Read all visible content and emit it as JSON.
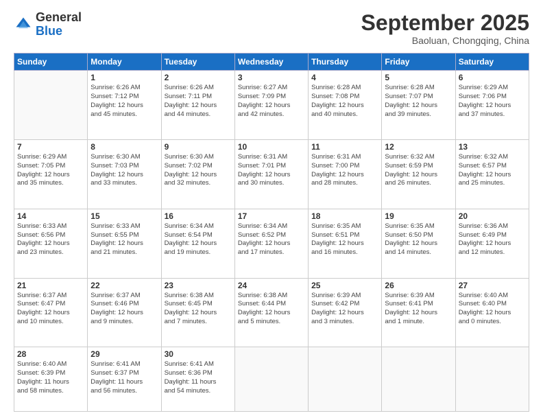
{
  "logo": {
    "general": "General",
    "blue": "Blue"
  },
  "header": {
    "month": "September 2025",
    "location": "Baoluan, Chongqing, China"
  },
  "weekdays": [
    "Sunday",
    "Monday",
    "Tuesday",
    "Wednesday",
    "Thursday",
    "Friday",
    "Saturday"
  ],
  "weeks": [
    [
      {
        "day": "",
        "info": ""
      },
      {
        "day": "1",
        "info": "Sunrise: 6:26 AM\nSunset: 7:12 PM\nDaylight: 12 hours\nand 45 minutes."
      },
      {
        "day": "2",
        "info": "Sunrise: 6:26 AM\nSunset: 7:11 PM\nDaylight: 12 hours\nand 44 minutes."
      },
      {
        "day": "3",
        "info": "Sunrise: 6:27 AM\nSunset: 7:09 PM\nDaylight: 12 hours\nand 42 minutes."
      },
      {
        "day": "4",
        "info": "Sunrise: 6:28 AM\nSunset: 7:08 PM\nDaylight: 12 hours\nand 40 minutes."
      },
      {
        "day": "5",
        "info": "Sunrise: 6:28 AM\nSunset: 7:07 PM\nDaylight: 12 hours\nand 39 minutes."
      },
      {
        "day": "6",
        "info": "Sunrise: 6:29 AM\nSunset: 7:06 PM\nDaylight: 12 hours\nand 37 minutes."
      }
    ],
    [
      {
        "day": "7",
        "info": "Sunrise: 6:29 AM\nSunset: 7:05 PM\nDaylight: 12 hours\nand 35 minutes."
      },
      {
        "day": "8",
        "info": "Sunrise: 6:30 AM\nSunset: 7:03 PM\nDaylight: 12 hours\nand 33 minutes."
      },
      {
        "day": "9",
        "info": "Sunrise: 6:30 AM\nSunset: 7:02 PM\nDaylight: 12 hours\nand 32 minutes."
      },
      {
        "day": "10",
        "info": "Sunrise: 6:31 AM\nSunset: 7:01 PM\nDaylight: 12 hours\nand 30 minutes."
      },
      {
        "day": "11",
        "info": "Sunrise: 6:31 AM\nSunset: 7:00 PM\nDaylight: 12 hours\nand 28 minutes."
      },
      {
        "day": "12",
        "info": "Sunrise: 6:32 AM\nSunset: 6:59 PM\nDaylight: 12 hours\nand 26 minutes."
      },
      {
        "day": "13",
        "info": "Sunrise: 6:32 AM\nSunset: 6:57 PM\nDaylight: 12 hours\nand 25 minutes."
      }
    ],
    [
      {
        "day": "14",
        "info": "Sunrise: 6:33 AM\nSunset: 6:56 PM\nDaylight: 12 hours\nand 23 minutes."
      },
      {
        "day": "15",
        "info": "Sunrise: 6:33 AM\nSunset: 6:55 PM\nDaylight: 12 hours\nand 21 minutes."
      },
      {
        "day": "16",
        "info": "Sunrise: 6:34 AM\nSunset: 6:54 PM\nDaylight: 12 hours\nand 19 minutes."
      },
      {
        "day": "17",
        "info": "Sunrise: 6:34 AM\nSunset: 6:52 PM\nDaylight: 12 hours\nand 17 minutes."
      },
      {
        "day": "18",
        "info": "Sunrise: 6:35 AM\nSunset: 6:51 PM\nDaylight: 12 hours\nand 16 minutes."
      },
      {
        "day": "19",
        "info": "Sunrise: 6:35 AM\nSunset: 6:50 PM\nDaylight: 12 hours\nand 14 minutes."
      },
      {
        "day": "20",
        "info": "Sunrise: 6:36 AM\nSunset: 6:49 PM\nDaylight: 12 hours\nand 12 minutes."
      }
    ],
    [
      {
        "day": "21",
        "info": "Sunrise: 6:37 AM\nSunset: 6:47 PM\nDaylight: 12 hours\nand 10 minutes."
      },
      {
        "day": "22",
        "info": "Sunrise: 6:37 AM\nSunset: 6:46 PM\nDaylight: 12 hours\nand 9 minutes."
      },
      {
        "day": "23",
        "info": "Sunrise: 6:38 AM\nSunset: 6:45 PM\nDaylight: 12 hours\nand 7 minutes."
      },
      {
        "day": "24",
        "info": "Sunrise: 6:38 AM\nSunset: 6:44 PM\nDaylight: 12 hours\nand 5 minutes."
      },
      {
        "day": "25",
        "info": "Sunrise: 6:39 AM\nSunset: 6:42 PM\nDaylight: 12 hours\nand 3 minutes."
      },
      {
        "day": "26",
        "info": "Sunrise: 6:39 AM\nSunset: 6:41 PM\nDaylight: 12 hours\nand 1 minute."
      },
      {
        "day": "27",
        "info": "Sunrise: 6:40 AM\nSunset: 6:40 PM\nDaylight: 12 hours\nand 0 minutes."
      }
    ],
    [
      {
        "day": "28",
        "info": "Sunrise: 6:40 AM\nSunset: 6:39 PM\nDaylight: 11 hours\nand 58 minutes."
      },
      {
        "day": "29",
        "info": "Sunrise: 6:41 AM\nSunset: 6:37 PM\nDaylight: 11 hours\nand 56 minutes."
      },
      {
        "day": "30",
        "info": "Sunrise: 6:41 AM\nSunset: 6:36 PM\nDaylight: 11 hours\nand 54 minutes."
      },
      {
        "day": "",
        "info": ""
      },
      {
        "day": "",
        "info": ""
      },
      {
        "day": "",
        "info": ""
      },
      {
        "day": "",
        "info": ""
      }
    ]
  ]
}
